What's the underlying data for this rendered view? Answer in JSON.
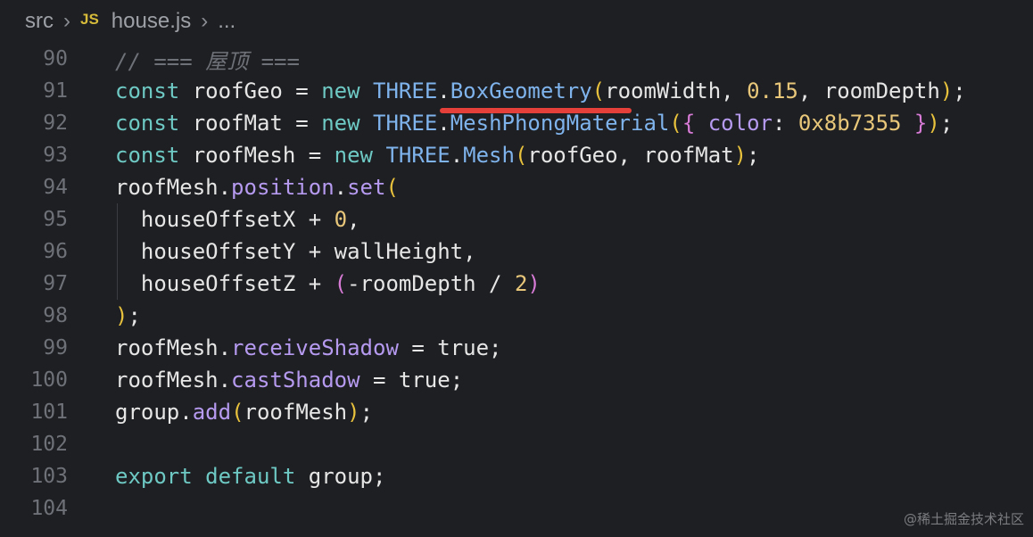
{
  "breadcrumb": {
    "folder": "src",
    "file_icon": "JS",
    "file": "house.js",
    "more": "..."
  },
  "editor": {
    "lines": [
      {
        "num": "90",
        "tokens": [
          {
            "t": "// === 屋顶 ===",
            "c": "cmt"
          }
        ]
      },
      {
        "num": "91",
        "tokens": [
          {
            "t": "const",
            "c": "kw"
          },
          {
            "t": " roofGeo = "
          },
          {
            "t": "new",
            "c": "kw"
          },
          {
            "t": " "
          },
          {
            "t": "THREE",
            "c": "cls"
          },
          {
            "t": "."
          },
          {
            "t": "BoxGeometry",
            "c": "cls"
          },
          {
            "t": "(",
            "c": "br-yellow"
          },
          {
            "t": "roomWidth, "
          },
          {
            "t": "0.15",
            "c": "num"
          },
          {
            "t": ", roomDepth"
          },
          {
            "t": ")",
            "c": "br-yellow"
          },
          {
            "t": ";"
          }
        ]
      },
      {
        "num": "92",
        "tokens": [
          {
            "t": "const",
            "c": "kw"
          },
          {
            "t": " roofMat = "
          },
          {
            "t": "new",
            "c": "kw"
          },
          {
            "t": " "
          },
          {
            "t": "THREE",
            "c": "cls"
          },
          {
            "t": "."
          },
          {
            "t": "MeshPhongMaterial",
            "c": "cls"
          },
          {
            "t": "(",
            "c": "br-yellow"
          },
          {
            "t": "{",
            "c": "br-purple"
          },
          {
            "t": " "
          },
          {
            "t": "color",
            "c": "prop"
          },
          {
            "t": ": "
          },
          {
            "t": "0x8b7355",
            "c": "num"
          },
          {
            "t": " "
          },
          {
            "t": "}",
            "c": "br-purple"
          },
          {
            "t": ")",
            "c": "br-yellow"
          },
          {
            "t": ";"
          }
        ]
      },
      {
        "num": "93",
        "tokens": [
          {
            "t": "const",
            "c": "kw"
          },
          {
            "t": " roofMesh = "
          },
          {
            "t": "new",
            "c": "kw"
          },
          {
            "t": " "
          },
          {
            "t": "THREE",
            "c": "cls"
          },
          {
            "t": "."
          },
          {
            "t": "Mesh",
            "c": "cls"
          },
          {
            "t": "(",
            "c": "br-yellow"
          },
          {
            "t": "roofGeo, roofMat"
          },
          {
            "t": ")",
            "c": "br-yellow"
          },
          {
            "t": ";"
          }
        ]
      },
      {
        "num": "94",
        "tokens": [
          {
            "t": "roofMesh."
          },
          {
            "t": "position",
            "c": "prop"
          },
          {
            "t": "."
          },
          {
            "t": "set",
            "c": "prop"
          },
          {
            "t": "(",
            "c": "br-yellow"
          }
        ]
      },
      {
        "num": "95",
        "tokens": [
          {
            "t": "  houseOffsetX + "
          },
          {
            "t": "0",
            "c": "num"
          },
          {
            "t": ","
          }
        ]
      },
      {
        "num": "96",
        "tokens": [
          {
            "t": "  houseOffsetY + wallHeight,"
          }
        ]
      },
      {
        "num": "97",
        "tokens": [
          {
            "t": "  houseOffsetZ + "
          },
          {
            "t": "(",
            "c": "br-purple"
          },
          {
            "t": "-roomDepth / "
          },
          {
            "t": "2",
            "c": "num"
          },
          {
            "t": ")",
            "c": "br-purple"
          }
        ]
      },
      {
        "num": "98",
        "tokens": [
          {
            "t": ")",
            "c": "br-yellow"
          },
          {
            "t": ";"
          }
        ]
      },
      {
        "num": "99",
        "tokens": [
          {
            "t": "roofMesh."
          },
          {
            "t": "receiveShadow",
            "c": "prop"
          },
          {
            "t": " = true;"
          }
        ]
      },
      {
        "num": "100",
        "tokens": [
          {
            "t": "roofMesh."
          },
          {
            "t": "castShadow",
            "c": "prop"
          },
          {
            "t": " = true;"
          }
        ]
      },
      {
        "num": "101",
        "tokens": [
          {
            "t": "group."
          },
          {
            "t": "add",
            "c": "prop"
          },
          {
            "t": "(",
            "c": "br-yellow"
          },
          {
            "t": "roofMesh"
          },
          {
            "t": ")",
            "c": "br-yellow"
          },
          {
            "t": ";"
          }
        ]
      },
      {
        "num": "102",
        "tokens": []
      },
      {
        "num": "103",
        "tokens": [
          {
            "t": "export",
            "c": "kw"
          },
          {
            "t": " "
          },
          {
            "t": "default",
            "c": "kw"
          },
          {
            "t": " group;"
          }
        ]
      },
      {
        "num": "104",
        "tokens": []
      }
    ]
  },
  "watermark": "@稀土掘金技术社区",
  "colors": {
    "background": "#1e1f22",
    "keyword": "#6ec9c4",
    "class": "#7fb3ec",
    "property": "#b59af0",
    "number": "#e8c77a",
    "highlight_underline": "#e5403a"
  }
}
